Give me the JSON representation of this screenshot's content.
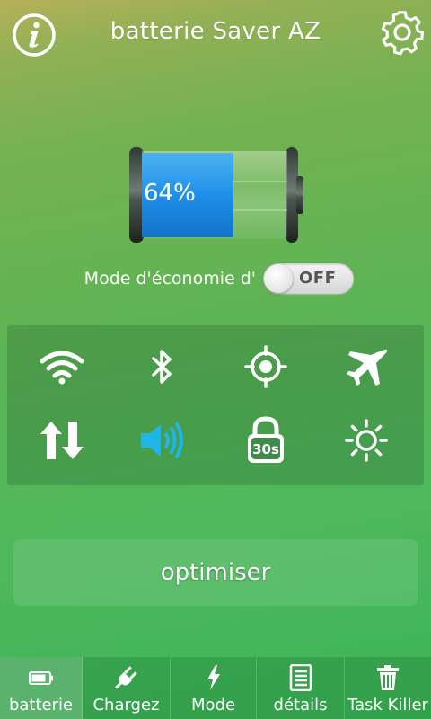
{
  "header": {
    "title": "batterie Saver AZ",
    "info_icon": "info-icon",
    "settings_icon": "gear-icon"
  },
  "battery": {
    "percent_label": "64%",
    "level": 0.64,
    "fill_color": "#1e8fe8"
  },
  "power_saving": {
    "label": "Mode d'économie d'",
    "toggle_state": "OFF"
  },
  "quick_toggles": [
    {
      "name": "wifi",
      "icon": "wifi-icon",
      "active": false
    },
    {
      "name": "bluetooth",
      "icon": "bluetooth-icon",
      "active": false
    },
    {
      "name": "gps",
      "icon": "gps-icon",
      "active": false
    },
    {
      "name": "airplane",
      "icon": "airplane-icon",
      "active": false
    },
    {
      "name": "mobile-data",
      "icon": "data-transfer-icon",
      "active": false
    },
    {
      "name": "sound",
      "icon": "speaker-icon",
      "active": true
    },
    {
      "name": "screen-timeout",
      "icon": "screen-lock-timer-icon",
      "timer_label": "30s",
      "active": false
    },
    {
      "name": "brightness",
      "icon": "brightness-icon",
      "active": false
    }
  ],
  "colors": {
    "active_icon": "#1fb5e8",
    "inactive_icon": "#ffffff"
  },
  "optimize_button": {
    "label": "optimiser"
  },
  "tabs": [
    {
      "label": "batterie",
      "icon": "battery-icon",
      "active": true
    },
    {
      "label": "Chargez",
      "icon": "plug-icon",
      "active": false
    },
    {
      "label": "Mode",
      "icon": "lightning-icon",
      "active": false
    },
    {
      "label": "détails",
      "icon": "document-icon",
      "active": false
    },
    {
      "label": "Task Killer",
      "icon": "trash-icon",
      "active": false
    }
  ]
}
